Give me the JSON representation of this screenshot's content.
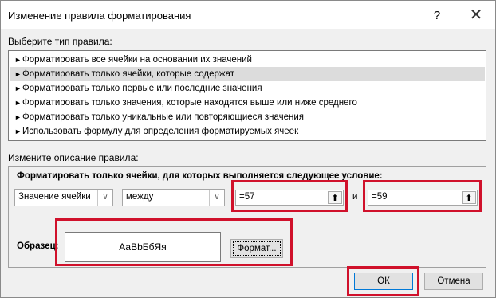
{
  "dialog": {
    "title": "Изменение правила форматирования",
    "help_label": "?",
    "close_label": "✕"
  },
  "rule_type": {
    "label": "Выберите тип правила:",
    "items": [
      {
        "label": "Форматировать все ячейки на основании их значений",
        "selected": false
      },
      {
        "label": "Форматировать только ячейки, которые содержат",
        "selected": true
      },
      {
        "label": "Форматировать только первые или последние значения",
        "selected": false
      },
      {
        "label": "Форматировать только значения, которые находятся выше или ниже среднего",
        "selected": false
      },
      {
        "label": "Форматировать только уникальные или повторяющиеся значения",
        "selected": false
      },
      {
        "label": "Использовать формулу для определения форматируемых ячеек",
        "selected": false
      }
    ],
    "item_arrow": "►"
  },
  "description": {
    "label": "Измените описание правила:",
    "condition_label": "Форматировать только ячейки, для которых выполняется следующее условие:",
    "field_select": "Значение ячейки",
    "operator_select": "между",
    "value1": "=57",
    "and_label": "и",
    "value2": "=59",
    "dropdown_glyph": "∨",
    "picker_glyph": "⬆"
  },
  "sample": {
    "label": "Образец:",
    "preview_text": "АаBbБбЯя",
    "format_button": "Формат..."
  },
  "buttons": {
    "ok": "ОК",
    "cancel": "Отмена"
  },
  "colors": {
    "highlight": "#d0112b",
    "selected_row": "#dcdcdc",
    "dialog_bg": "#f0f0f0"
  }
}
